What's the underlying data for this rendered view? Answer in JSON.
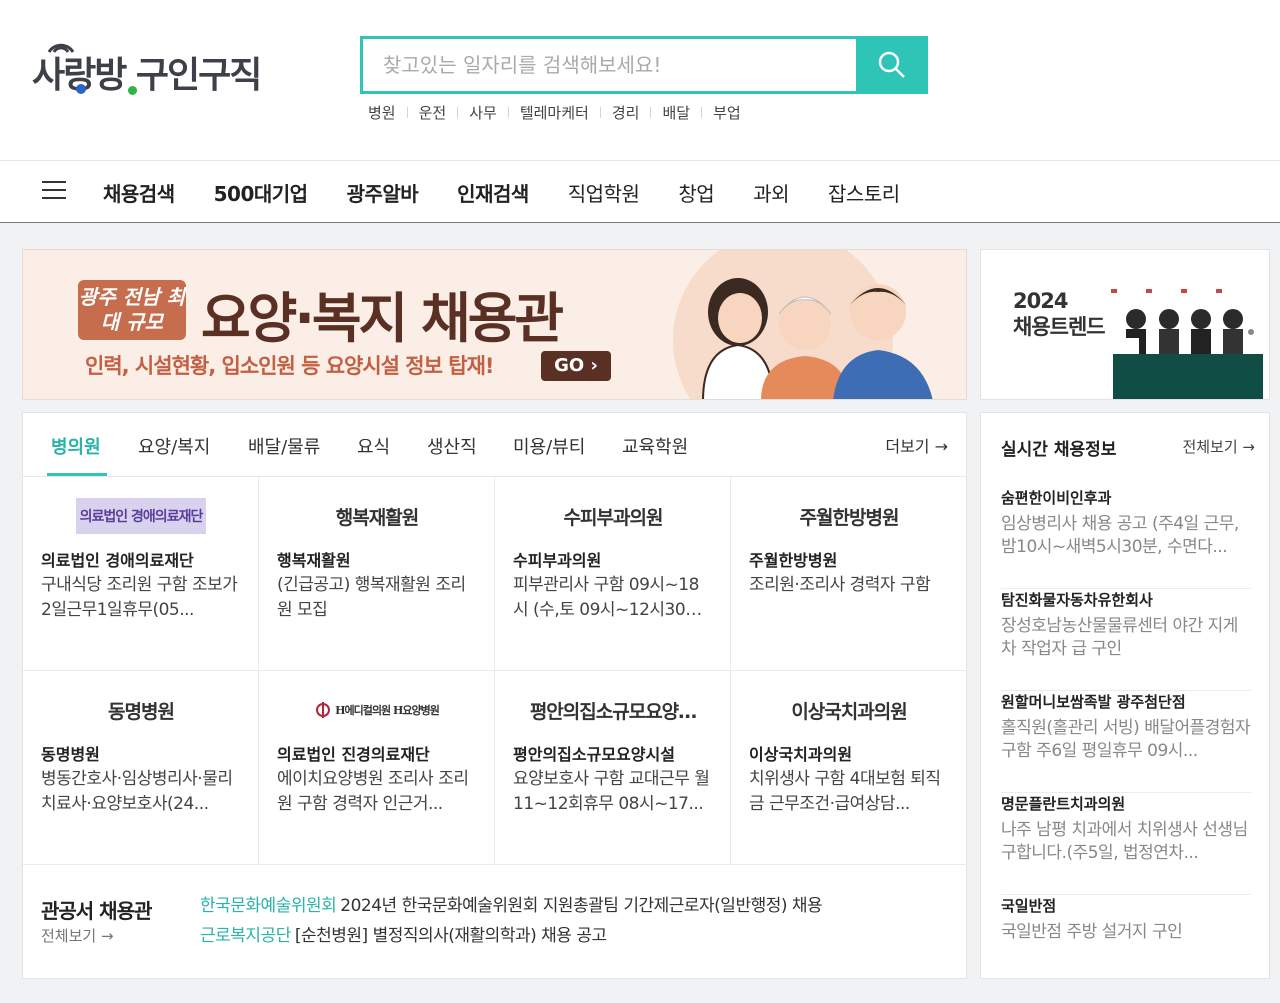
{
  "header": {
    "logo_text": "사랑방 구인구직",
    "search_placeholder": "찾고있는 일자리를 검색해보세요!",
    "keywords": [
      "병원",
      "운전",
      "사무",
      "텔레마케터",
      "경리",
      "배달",
      "부업"
    ]
  },
  "nav": {
    "items": [
      {
        "label": "채용검색",
        "bold": true
      },
      {
        "label": "500대기업",
        "bold": true
      },
      {
        "label": "광주알바",
        "bold": true
      },
      {
        "label": "인재검색",
        "bold": true
      },
      {
        "label": "직업학원",
        "bold": false
      },
      {
        "label": "창업",
        "bold": false
      },
      {
        "label": "과외",
        "bold": false
      },
      {
        "label": "잡스토리",
        "bold": false
      }
    ]
  },
  "banner": {
    "tag": "광주 전남 최대 규모",
    "title": "요양·복지 채용관",
    "subtitle": "인력, 시설현황, 입소인원 등 요양시설 정보 탑재!",
    "go": "GO ›"
  },
  "side_banner": {
    "title": "2024\n채용트렌드"
  },
  "tabs": {
    "items": [
      "병의원",
      "요양/복지",
      "배달/물류",
      "요식",
      "생산직",
      "미용/뷰티",
      "교육학원"
    ],
    "active": "병의원",
    "more": "더보기 →"
  },
  "listings": [
    {
      "logo": "의료법인 경애의료재단",
      "logo_style": "boxed",
      "company": "의료법인 경애의료재단",
      "desc": "구내식당 조리원 구함 조보가 2일근무1일휴무(05..."
    },
    {
      "logo": "행복재활원",
      "logo_style": "text",
      "company": "행복재활원",
      "desc": "(긴급공고) 행복재활원 조리원 모집"
    },
    {
      "logo": "수피부과의원",
      "logo_style": "text",
      "company": "수피부과의원",
      "desc": "피부관리사 구함 09시~18시 (수,토 09시~12시30분,..."
    },
    {
      "logo": "주월한방병원",
      "logo_style": "text",
      "company": "주월한방병원",
      "desc": "조리원·조리사 경력자 구함"
    },
    {
      "logo": "동명병원",
      "logo_style": "text",
      "company": "동명병원",
      "desc": "병동간호사·임상병리사·물리치료사·요양보호사(24..."
    },
    {
      "logo": "H에디컬의원 H요양병원",
      "logo_style": "small",
      "company": "의료법인 진경의료재단",
      "desc": "에이치요양병원 조리사 조리원 구함 경력자 인근거..."
    },
    {
      "logo": "평안의집소규모요양…",
      "logo_style": "text",
      "company": "평안의집소규모요양시설",
      "desc": "요양보호사 구함 교대근무 월11~12회휴무 08시~17..."
    },
    {
      "logo": "이상국치과의원",
      "logo_style": "text",
      "company": "이상국치과의원",
      "desc": "치위생사 구함 4대보험 퇴직금 근무조건·급여상담..."
    }
  ],
  "gov": {
    "title": "관공서 채용관",
    "all": "전체보기 →",
    "rows": [
      {
        "org": "한국문화예술위원회",
        "text": "2024년 한국문화예술위원회 지원총괄팀 기간제근로자(일반행정) 채용"
      },
      {
        "org": "근로복지공단",
        "text": "[순천병원] 별정직의사(재활의학과) 채용 공고"
      }
    ]
  },
  "realtime": {
    "title": "실시간 채용정보",
    "all": "전체보기 →",
    "items": [
      {
        "company": "숨편한이비인후과",
        "desc": "임상병리사 채용 공고 (주4일 근무, 밤10시~새벽5시30분, 수면다..."
      },
      {
        "company": "탐진화물자동차유한회사",
        "desc": "장성호남농산물물류센터 야간 지게차 작업자 급 구인"
      },
      {
        "company": "원할머니보쌈족발 광주첨단점",
        "desc": "홀직원(홀관리 서빙) 배달어플경험자 구함 주6일 평일휴무 09시..."
      },
      {
        "company": "명문플란트치과의원",
        "desc": "나주 남평 치과에서 치위생사 선생님 구합니다.(주5일, 법정연차..."
      },
      {
        "company": "국일반점",
        "desc": "국일반점 주방 설거지 구인"
      }
    ]
  },
  "colors": {
    "accent": "#2ec4b6",
    "accent_text": "#2ab3a8",
    "banner_bg": "#fbeee6",
    "banner_title": "#5a3024"
  }
}
